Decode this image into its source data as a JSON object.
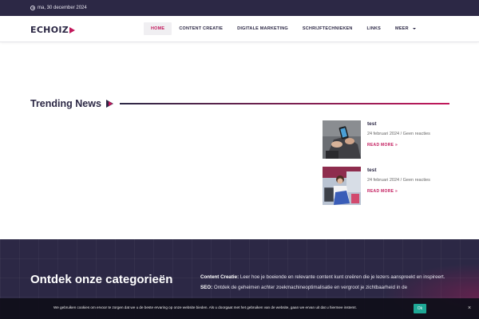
{
  "topbar": {
    "date": "ma, 30 december 2024"
  },
  "header": {
    "logo_text": "ECHOIZ",
    "nav": [
      {
        "label": "HOME",
        "active": true
      },
      {
        "label": "CONTENT CREATIE",
        "active": false
      },
      {
        "label": "DIGITALE MARKETING",
        "active": false
      },
      {
        "label": "SCHRIJFTECHNIEKEN",
        "active": false
      },
      {
        "label": "LINKS",
        "active": false
      },
      {
        "label": "MEER",
        "active": false
      }
    ]
  },
  "trending": {
    "title": "Trending News",
    "posts": [
      {
        "title": "test",
        "date": "24 februari 2024 / Geen reacties",
        "read_more": "READ MORE »",
        "thumb": "person-with-smartphone"
      },
      {
        "title": "test",
        "date": "24 februari 2024 / Geen reacties",
        "read_more": "READ MORE »",
        "thumb": "person-with-luggage"
      }
    ]
  },
  "categories": {
    "heading": "Ontdek onze categorieën",
    "items": [
      {
        "label": "Content Creatie:",
        "text": "Leer hoe je boeiende en relevante content kunt creëren die je lezers aanspreekt en inspireert."
      },
      {
        "label": "SEO:",
        "text": "Ontdek de geheimen achter zoekmachineoptimalisatie en vergroot je zichtbaarheid in de"
      }
    ]
  },
  "cookie": {
    "message": "We gebruiken cookies om ervoor te zorgen dat we u de beste ervaring op onze website bieden. Als u doorgaat met het gebruiken van de website, gaan we ervan uit dat u hiermee instemt.",
    "ok_label": "Ok",
    "close_label": "×"
  },
  "colors": {
    "navy": "#2c2845",
    "accent": "#c2185b",
    "ok_button": "#1ea896"
  }
}
